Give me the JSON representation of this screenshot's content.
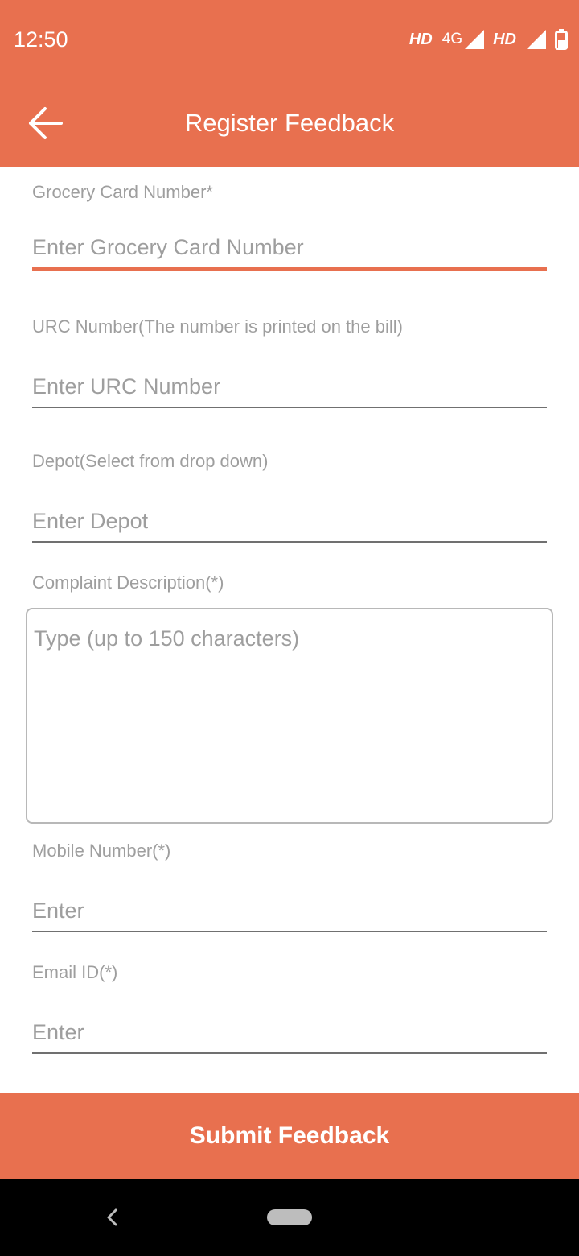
{
  "status_bar": {
    "time": "12:50",
    "hd_1": "HD",
    "network": "4G",
    "hd_2": "HD",
    "icons": [
      "signal-icon",
      "signal-icon",
      "battery-icon"
    ]
  },
  "app_bar": {
    "title": "Register Feedback",
    "back_icon": "arrow-left-icon"
  },
  "form": {
    "grocery_card": {
      "label": "Grocery Card Number*",
      "placeholder": "Enter Grocery Card Number",
      "value": ""
    },
    "urc": {
      "label": "URC Number(The number is printed on the bill)",
      "placeholder": "Enter URC Number",
      "value": ""
    },
    "depot": {
      "label": "Depot(Select from drop down)",
      "placeholder": "Enter Depot",
      "value": ""
    },
    "description": {
      "label": "Complaint Description(*)",
      "placeholder": "Type (up to 150 characters)",
      "value": ""
    },
    "mobile": {
      "label": "Mobile Number(*)",
      "placeholder": "Enter",
      "value": ""
    },
    "email": {
      "label": "Email ID(*)",
      "placeholder": "Enter",
      "value": ""
    }
  },
  "submit": {
    "label": "Submit Feedback"
  },
  "nav_bar": {
    "icons": [
      "nav-back-icon",
      "nav-home-pill"
    ]
  },
  "colors": {
    "accent": "#e8704f",
    "label_text": "#9e9e9e",
    "underline": "#707070",
    "nav_background": "#000000"
  }
}
